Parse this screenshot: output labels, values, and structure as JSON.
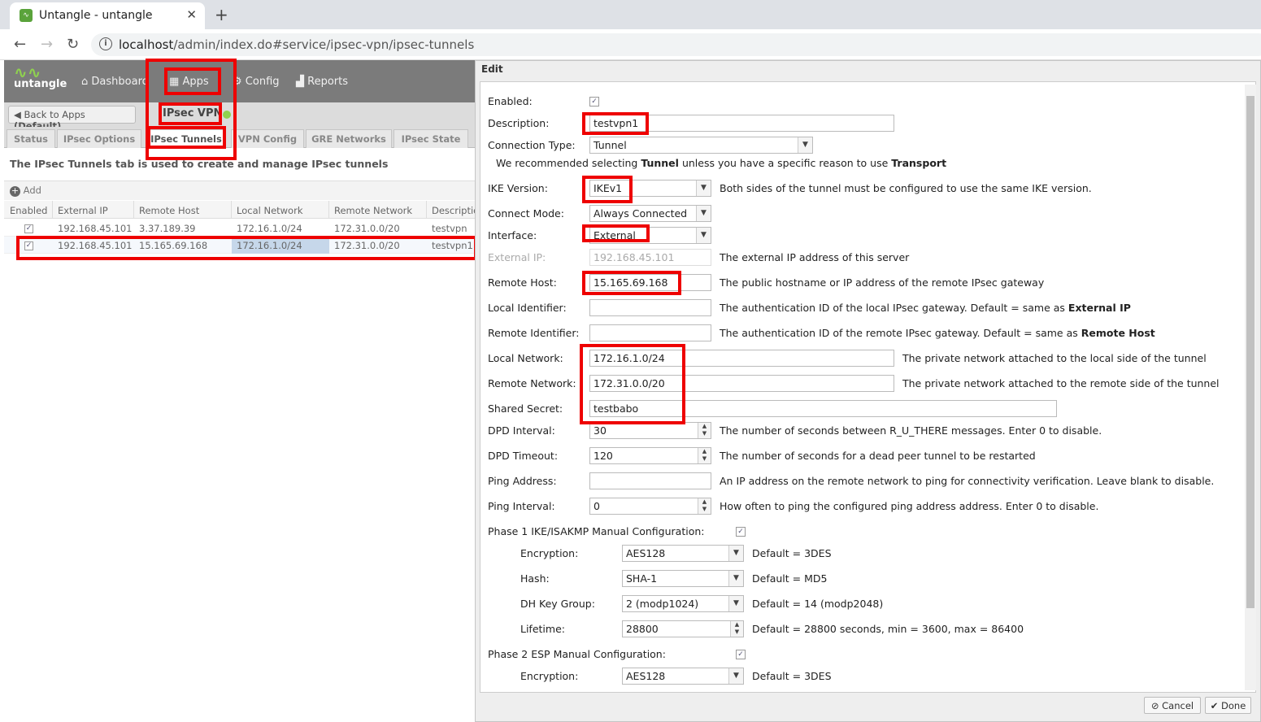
{
  "browser": {
    "tab_title": "Untangle - untangle",
    "url_host": "localhost",
    "url_path": "/admin/index.do#service/ipsec-vpn/ipsec-tunnels"
  },
  "app": {
    "logo": "untangle",
    "nav": {
      "dashboard": "Dashboard",
      "apps": "Apps",
      "config": "Config",
      "reports": "Reports"
    },
    "back_label": "Back to Apps",
    "back_default": "(Default)",
    "app_title": "IPsec VPN",
    "tabs": [
      "Status",
      "IPsec Options",
      "IPsec Tunnels",
      "VPN Config",
      "GRE Networks",
      "IPsec State"
    ],
    "description": "The IPsec Tunnels tab is used to create and manage IPsec tunnels",
    "add_label": "Add",
    "grid_columns": [
      "Enabled",
      "External IP",
      "Remote Host",
      "Local Network",
      "Remote Network",
      "Descriptio"
    ],
    "grid_rows": [
      {
        "external_ip": "192.168.45.101",
        "remote_host": "3.37.189.39",
        "local_network": "172.16.1.0/24",
        "remote_network": "172.31.0.0/20",
        "description": "testvpn"
      },
      {
        "external_ip": "192.168.45.101",
        "remote_host": "15.165.69.168",
        "local_network": "172.16.1.0/24",
        "remote_network": "172.31.0.0/20",
        "description": "testvpn1"
      }
    ]
  },
  "edit": {
    "title": "Edit",
    "labels": {
      "enabled": "Enabled:",
      "description": "Description:",
      "connection_type": "Connection Type:",
      "ike_version": "IKE Version:",
      "connect_mode": "Connect Mode:",
      "interface": "Interface:",
      "external_ip": "External IP:",
      "remote_host": "Remote Host:",
      "local_identifier": "Local Identifier:",
      "remote_identifier": "Remote Identifier:",
      "local_network": "Local Network:",
      "remote_network": "Remote Network:",
      "shared_secret": "Shared Secret:",
      "dpd_interval": "DPD Interval:",
      "dpd_timeout": "DPD Timeout:",
      "ping_address": "Ping Address:",
      "ping_interval": "Ping Interval:",
      "phase1": "Phase 1 IKE/ISAKMP Manual Configuration:",
      "encryption": "Encryption:",
      "hash": "Hash:",
      "dh_key_group": "DH Key Group:",
      "lifetime": "Lifetime:",
      "phase2": "Phase 2 ESP Manual Configuration:",
      "encryption2": "Encryption:"
    },
    "values": {
      "description": "testvpn1",
      "connection_type": "Tunnel",
      "ike_version": "IKEv1",
      "connect_mode": "Always Connected",
      "interface": "External",
      "external_ip": "192.168.45.101",
      "remote_host": "15.165.69.168",
      "local_identifier": "",
      "remote_identifier": "",
      "local_network": "172.16.1.0/24",
      "remote_network": "172.31.0.0/20",
      "shared_secret": "testbabo",
      "dpd_interval": "30",
      "dpd_timeout": "120",
      "ping_address": "",
      "ping_interval": "0",
      "p1_encryption": "AES128",
      "p1_hash": "SHA-1",
      "p1_dh": "2 (modp1024)",
      "p1_lifetime": "28800",
      "p2_encryption": "AES128"
    },
    "hints": {
      "rec_pre": "We recommended selecting",
      "rec_b1": "Tunnel",
      "rec_mid": "unless you have a specific reason to use",
      "rec_b2": "Transport",
      "ike": "Both sides of the tunnel must be configured to use the same IKE version.",
      "external_ip": "The external IP address of this server",
      "remote_host": "The public hostname or IP address of the remote IPsec gateway",
      "local_id_pre": "The authentication ID of the local IPsec gateway. Default = same as",
      "local_id_b": "External IP",
      "remote_id_pre": "The authentication ID of the remote IPsec gateway. Default = same as",
      "remote_id_b": "Remote Host",
      "local_network": "The private network attached to the local side of the tunnel",
      "remote_network": "The private network attached to the remote side of the tunnel",
      "dpd_interval": "The number of seconds between R_U_THERE messages. Enter 0 to disable.",
      "dpd_timeout": "The number of seconds for a dead peer tunnel to be restarted",
      "ping_address": "An IP address on the remote network to ping for connectivity verification. Leave blank to disable.",
      "ping_interval": "How often to ping the configured ping address address. Enter 0 to disable.",
      "p1_encryption": "Default = 3DES",
      "p1_hash": "Default = MD5",
      "p1_dh": "Default = 14 (modp2048)",
      "p1_lifetime": "Default = 28800 seconds, min = 3600, max = 86400",
      "p2_encryption": "Default = 3DES"
    },
    "buttons": {
      "cancel": "Cancel",
      "done": "Done"
    }
  },
  "colors": {
    "highlight": "#e00000",
    "brand_green": "#8fd14f"
  }
}
